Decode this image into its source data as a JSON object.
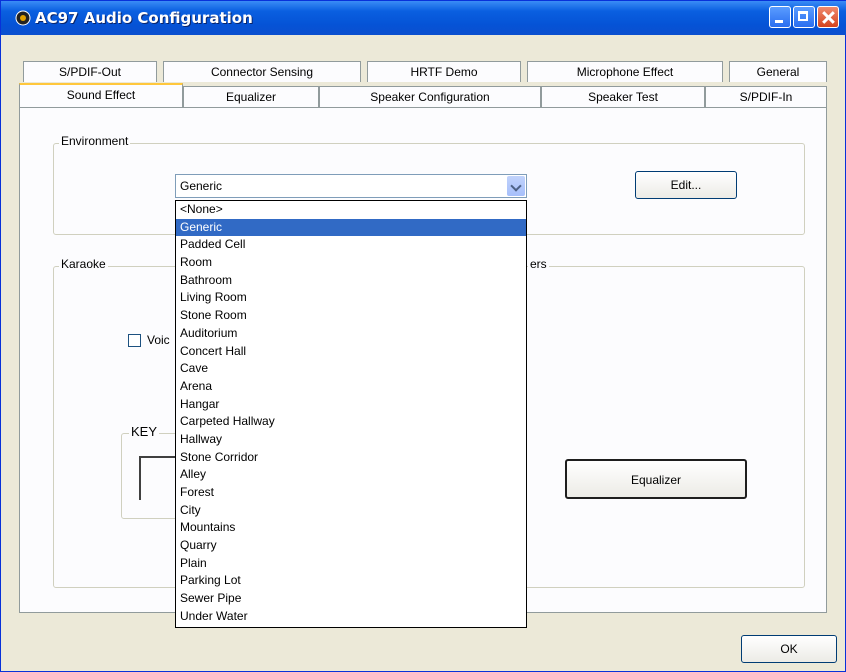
{
  "window": {
    "title": "AC97 Audio Configuration"
  },
  "tabs_row1": [
    "S/PDIF-Out",
    "Connector Sensing",
    "HRTF Demo",
    "Microphone Effect",
    "General"
  ],
  "tabs_row2": [
    "Sound Effect",
    "Equalizer",
    "Speaker Configuration",
    "Speaker Test",
    "S/PDIF-In"
  ],
  "active_tab": "Sound Effect",
  "environment": {
    "legend": "Environment",
    "selected": "Generic",
    "edit_label": "Edit..."
  },
  "karaoke": {
    "legend": "Karaoke",
    "voice_label": "Voic",
    "key_label": "KEY"
  },
  "others": {
    "legend_fragment": "ers",
    "equalizer_label": "Equalizer"
  },
  "dropdown": {
    "items": [
      "<None>",
      "Generic",
      "Padded Cell",
      "Room",
      "Bathroom",
      "Living Room",
      "Stone Room",
      "Auditorium",
      "Concert Hall",
      "Cave",
      "Arena",
      "Hangar",
      "Carpeted Hallway",
      "Hallway",
      "Stone Corridor",
      "Alley",
      "Forest",
      "City",
      "Mountains",
      "Quarry",
      "Plain",
      "Parking Lot",
      "Sewer Pipe",
      "Under Water"
    ],
    "selected_index": 1
  },
  "footer": {
    "ok_label": "OK"
  },
  "colors": {
    "titlebar": "#0553d6",
    "selection": "#316ac5",
    "tab_highlight": "#ffc73c"
  }
}
